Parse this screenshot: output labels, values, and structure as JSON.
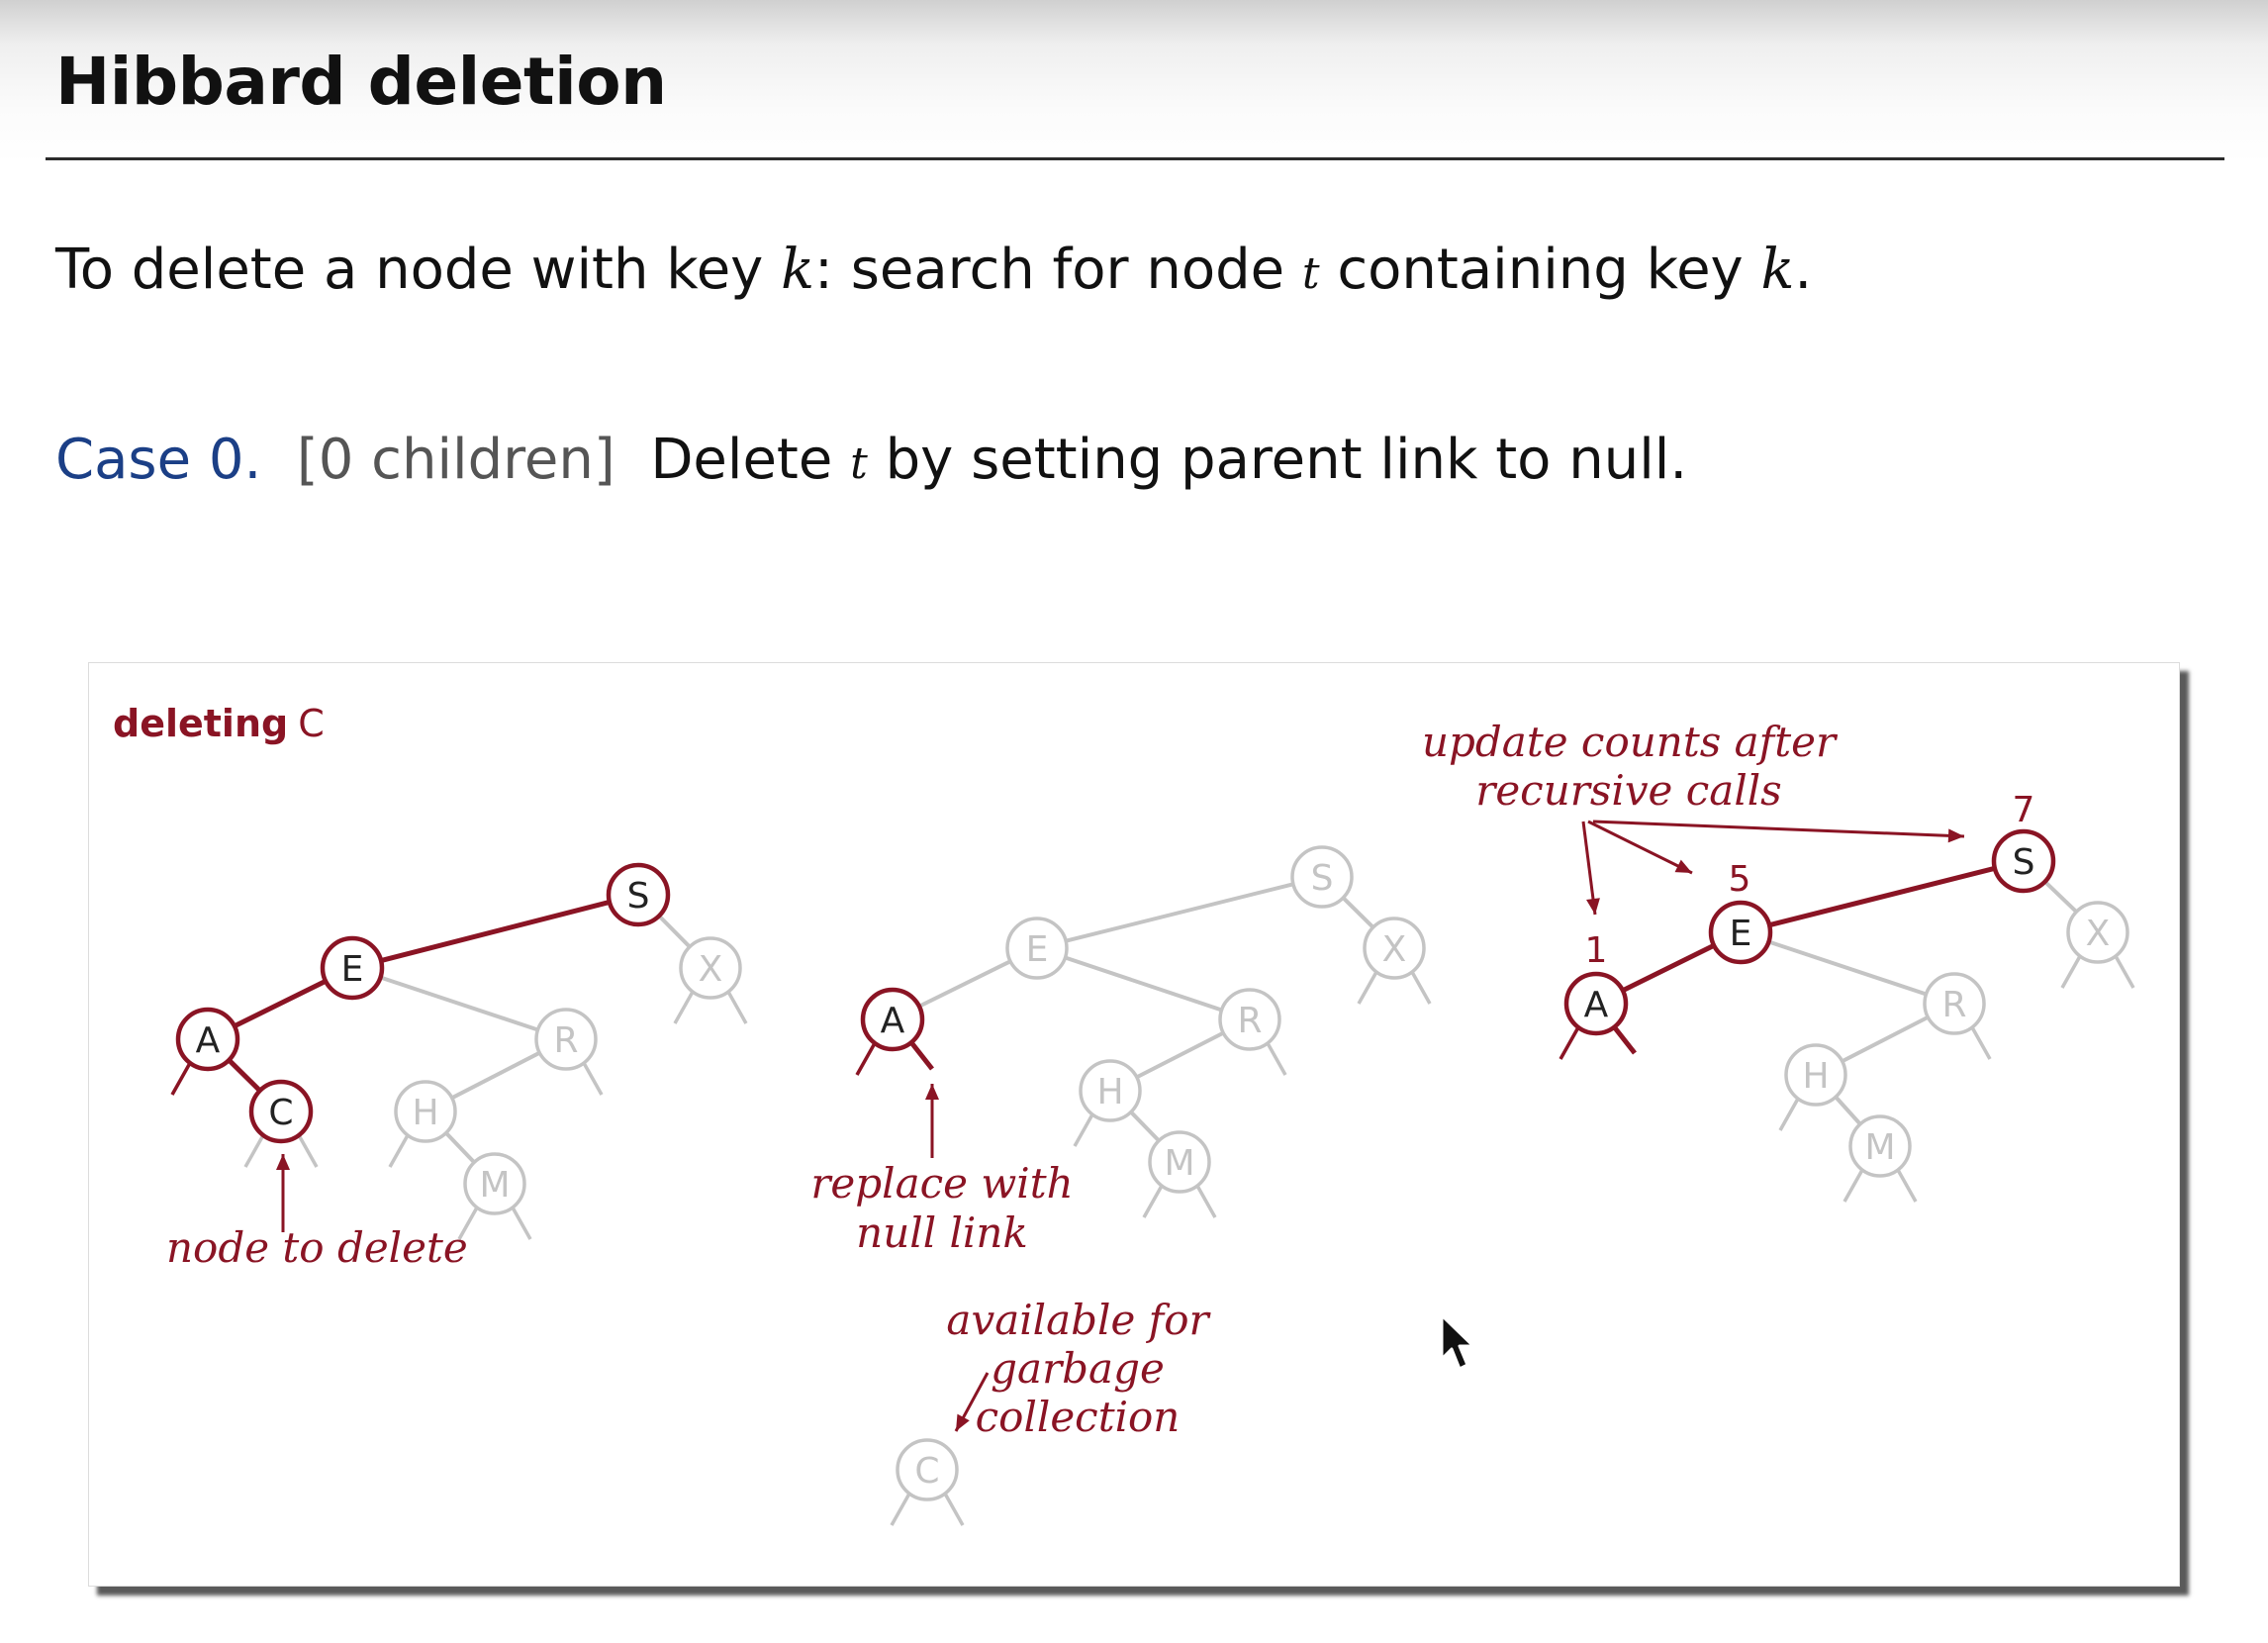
{
  "slide": {
    "title": "Hibbard deletion",
    "intro": {
      "prefix": "To delete a node with key ",
      "key_var": "k",
      "middle": ":  search for node ",
      "node_var": "t",
      "suffix": " containing key ",
      "key_var_2": "k",
      "end": "."
    },
    "case": {
      "label": "Case 0.",
      "bracket": "[0 children]",
      "prefix": "Delete ",
      "node_var": "t",
      "suffix": " by setting parent link to null."
    }
  },
  "figure": {
    "title_bold": "deleting",
    "title_key": "C",
    "trees": [
      {
        "name": "before",
        "nodes": [
          "S",
          "X",
          "E",
          "A",
          "R",
          "C",
          "H",
          "M"
        ],
        "highlighted": [
          "S",
          "E",
          "A",
          "C"
        ],
        "annotation": [
          "node to delete"
        ]
      },
      {
        "name": "after-removal",
        "nodes": [
          "S",
          "X",
          "E",
          "R",
          "A",
          "H",
          "M"
        ],
        "highlighted": [
          "A"
        ],
        "annotation": [
          "replace with",
          "null link"
        ]
      },
      {
        "name": "garbage",
        "nodes": [
          "C"
        ],
        "annotation": [
          "available for",
          "garbage",
          "collection"
        ]
      },
      {
        "name": "after-counts",
        "nodes": [
          "S",
          "X",
          "E",
          "R",
          "A",
          "H",
          "M"
        ],
        "highlighted": [
          "S",
          "E",
          "A"
        ],
        "counts": [
          {
            "node": "S",
            "value": "7"
          },
          {
            "node": "E",
            "value": "5"
          },
          {
            "node": "A",
            "value": "1"
          }
        ],
        "annotation": [
          "update counts after",
          "recursive calls"
        ]
      }
    ],
    "colors": {
      "highlight": "#8a1424",
      "faded": "#c4c4c4",
      "title_text": "#111111",
      "case_label": "#1b3f86"
    }
  },
  "cursor": {
    "icon": "mouse-pointer-icon"
  }
}
